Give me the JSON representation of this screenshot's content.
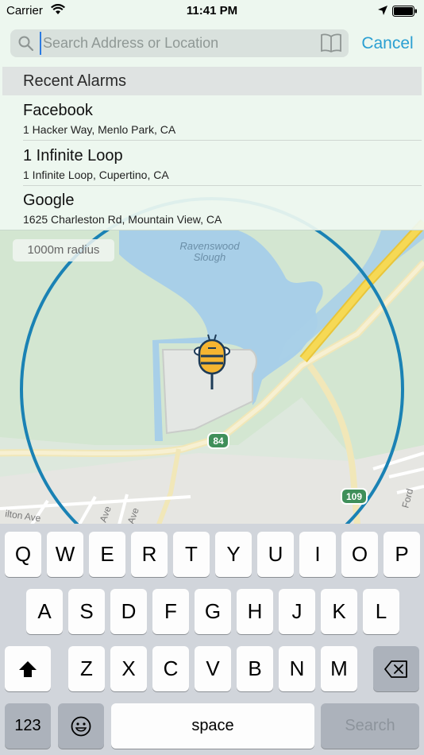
{
  "status_bar": {
    "carrier": "Carrier",
    "time": "11:41 PM"
  },
  "search": {
    "placeholder": "Search Address or Location",
    "value": "",
    "cancel_label": "Cancel"
  },
  "recent": {
    "header": "Recent Alarms",
    "items": [
      {
        "name": "Facebook",
        "address": "1 Hacker Way, Menlo Park, CA"
      },
      {
        "name": "1 Infinite Loop",
        "address": "1 Infinite Loop, Cupertino, CA"
      },
      {
        "name": "Google",
        "address": "1625 Charleston Rd, Mountain View, CA"
      }
    ]
  },
  "map": {
    "radius_label": "1000m radius",
    "place_label_1": "Ravenswood",
    "place_label_2": "Slough",
    "route_84": "84",
    "route_109": "109",
    "street_1": "ilton Ave",
    "street_2": "Ave",
    "street_3": "Ave",
    "street_4": "Ford"
  },
  "keyboard": {
    "row1": [
      "Q",
      "W",
      "E",
      "R",
      "T",
      "Y",
      "U",
      "I",
      "O",
      "P"
    ],
    "row2": [
      "A",
      "S",
      "D",
      "F",
      "G",
      "H",
      "J",
      "K",
      "L"
    ],
    "row3": [
      "Z",
      "X",
      "C",
      "V",
      "B",
      "N",
      "M"
    ],
    "numbers_label": "123",
    "space_label": "space",
    "search_label": "Search"
  },
  "colors": {
    "accent": "#2a9fd2",
    "radius_ring": "#1a82b4",
    "water": "#a6cfe9",
    "highway": "#f5d64a",
    "park": "#cfe4cb"
  }
}
